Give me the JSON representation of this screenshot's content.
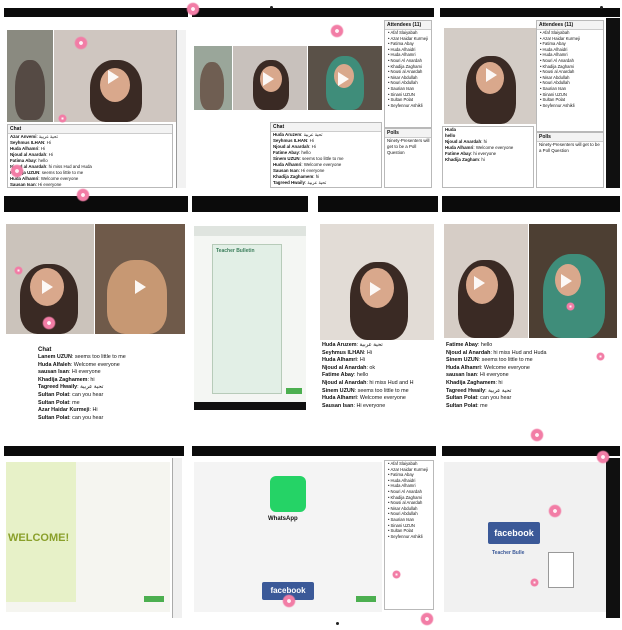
{
  "chat_label": "Chat",
  "polls_label": "Polls",
  "attendees_label": "Attendees (11)",
  "poll_text": "Ninety-Presenters will get to be a Poll Question",
  "attendees": [
    "Afaf Slaiyabah",
    "Azar Haidar Kurmeji",
    "Fatima Abay",
    "Huda Alhaidri",
    "Huda Alhamri",
    "Nouri Al Anardah",
    "Khadija Zaghami",
    "Nousi al Anardah",
    "Nisar Abdullah",
    "Nouri Abdullah",
    "Saurian Isan",
    "Sinani UZUN",
    "Sultan Polat",
    "Seyfennur Ashikli"
  ],
  "t1_chat": [
    {
      "n": "Azar Anvemi",
      "m": "تحية عربية"
    },
    {
      "n": "Seyhmus ILHAN",
      "m": "Hi"
    },
    {
      "n": "Huda Alhamri",
      "m": "Hi"
    },
    {
      "n": "Njoud al Anardah",
      "m": "Hi"
    },
    {
      "n": "Fatima Abay",
      "m": "hello"
    },
    {
      "n": "Njoud al Anardah",
      "m": "hi miss Hud and Huda"
    },
    {
      "n": "Khadija UZUN",
      "m": "seems too little to me"
    },
    {
      "n": "Huda Alhamri",
      "m": "Welcome everyone"
    },
    {
      "n": "Sausan Isan",
      "m": "Hi everyone"
    }
  ],
  "t2_chat": [
    {
      "n": "Huda Aruzem",
      "m": "تحية عربية"
    },
    {
      "n": "Seyhmus ILHAN",
      "m": "Hi"
    },
    {
      "n": "Njoud al Anardah",
      "m": "Hi"
    },
    {
      "n": "Fatime Abay",
      "m": "hello"
    },
    {
      "n": "Sinem UZUN",
      "m": "seems too little to me"
    },
    {
      "n": "Huda Alhamri",
      "m": "Welcome everyone"
    },
    {
      "n": "Sausan Isan",
      "m": "Hi everyone"
    },
    {
      "n": "Khadija Zaghamem",
      "m": "hi"
    },
    {
      "n": "Tagreed Hwaily",
      "m": "تحية عربية"
    }
  ],
  "t3_chat": [
    {
      "n": "Huda",
      "m": ""
    },
    {
      "n": "hello",
      "m": ""
    },
    {
      "n": "Njoud al Anardah",
      "m": "hi"
    },
    {
      "n": "Huda Alhamri",
      "m": "Welcome everyone"
    },
    {
      "n": "Fatime Abay",
      "m": "hi everyone"
    },
    {
      "n": "Khadija Zagham",
      "m": "hi"
    }
  ],
  "t5_chat": [
    {
      "n": "Lanem UZUN",
      "m": "seems too little to me"
    },
    {
      "n": "Huda Alfaleh",
      "m": "Welcome everyone"
    },
    {
      "n": "sausan Isan",
      "m": "Hi everyone"
    },
    {
      "n": "Khadija Zaghamem",
      "m": "hi"
    },
    {
      "n": "Tagreed Hwaily",
      "m": "تحية عربية"
    },
    {
      "n": "Sultan Polat",
      "m": "can you hear"
    },
    {
      "n": "Sultan Polat",
      "m": "me"
    },
    {
      "n": "Azar Haidar Kurmeji",
      "m": "Hi"
    },
    {
      "n": "Sultan Polat",
      "m": "can you hear"
    }
  ],
  "t7_chat": [
    {
      "n": "Huda Aruzem",
      "m": "تحية عربية"
    },
    {
      "n": "Seyhmus ILHAN",
      "m": "Hi"
    },
    {
      "n": "Huda Alhamri",
      "m": "Hi"
    },
    {
      "n": "Njoud al Anardah",
      "m": "ok"
    },
    {
      "n": "Fatime Abay",
      "m": "hello"
    },
    {
      "n": "Njoud al Anardah",
      "m": "hi miss Hud and H"
    },
    {
      "n": "Sinem UZUN",
      "m": "seems too little to me"
    },
    {
      "n": "Huda Alhamri",
      "m": "Welcome everyone"
    },
    {
      "n": "Sausan Isan",
      "m": "Hi everyone"
    }
  ],
  "t8_chat": [
    {
      "n": "Fatime Abay",
      "m": "hello"
    },
    {
      "n": "Njoud al Anardah",
      "m": "hi miss Hud and Huda"
    },
    {
      "n": "Sinem UZUN",
      "m": "seems too little to me"
    },
    {
      "n": "Huda Alhamri",
      "m": "Welcome everyone"
    },
    {
      "n": "sausan Isan",
      "m": "Hi everyone"
    },
    {
      "n": "Khadija Zaghamem",
      "m": "hi"
    },
    {
      "n": "Tagreed Hwaily",
      "m": "تحية عربية"
    },
    {
      "n": "Sultan Polat",
      "m": "can you hear"
    },
    {
      "n": "Sultan Polat",
      "m": "me"
    }
  ],
  "t6_screen": {
    "title": "Teacher Bulletin"
  },
  "t9_screen": {
    "welcome": "WELCOME!"
  },
  "t10_screen": {
    "brand": "WhatsApp",
    "fb": "facebook"
  },
  "t11_screen": {
    "fb": "facebook",
    "teacher": "Teacher Bulle"
  },
  "colors": {
    "accent_flower": "#f27da6",
    "facebook": "#3b5998",
    "whatsapp": "#25d366",
    "titlebar": "#0b0b0b"
  }
}
